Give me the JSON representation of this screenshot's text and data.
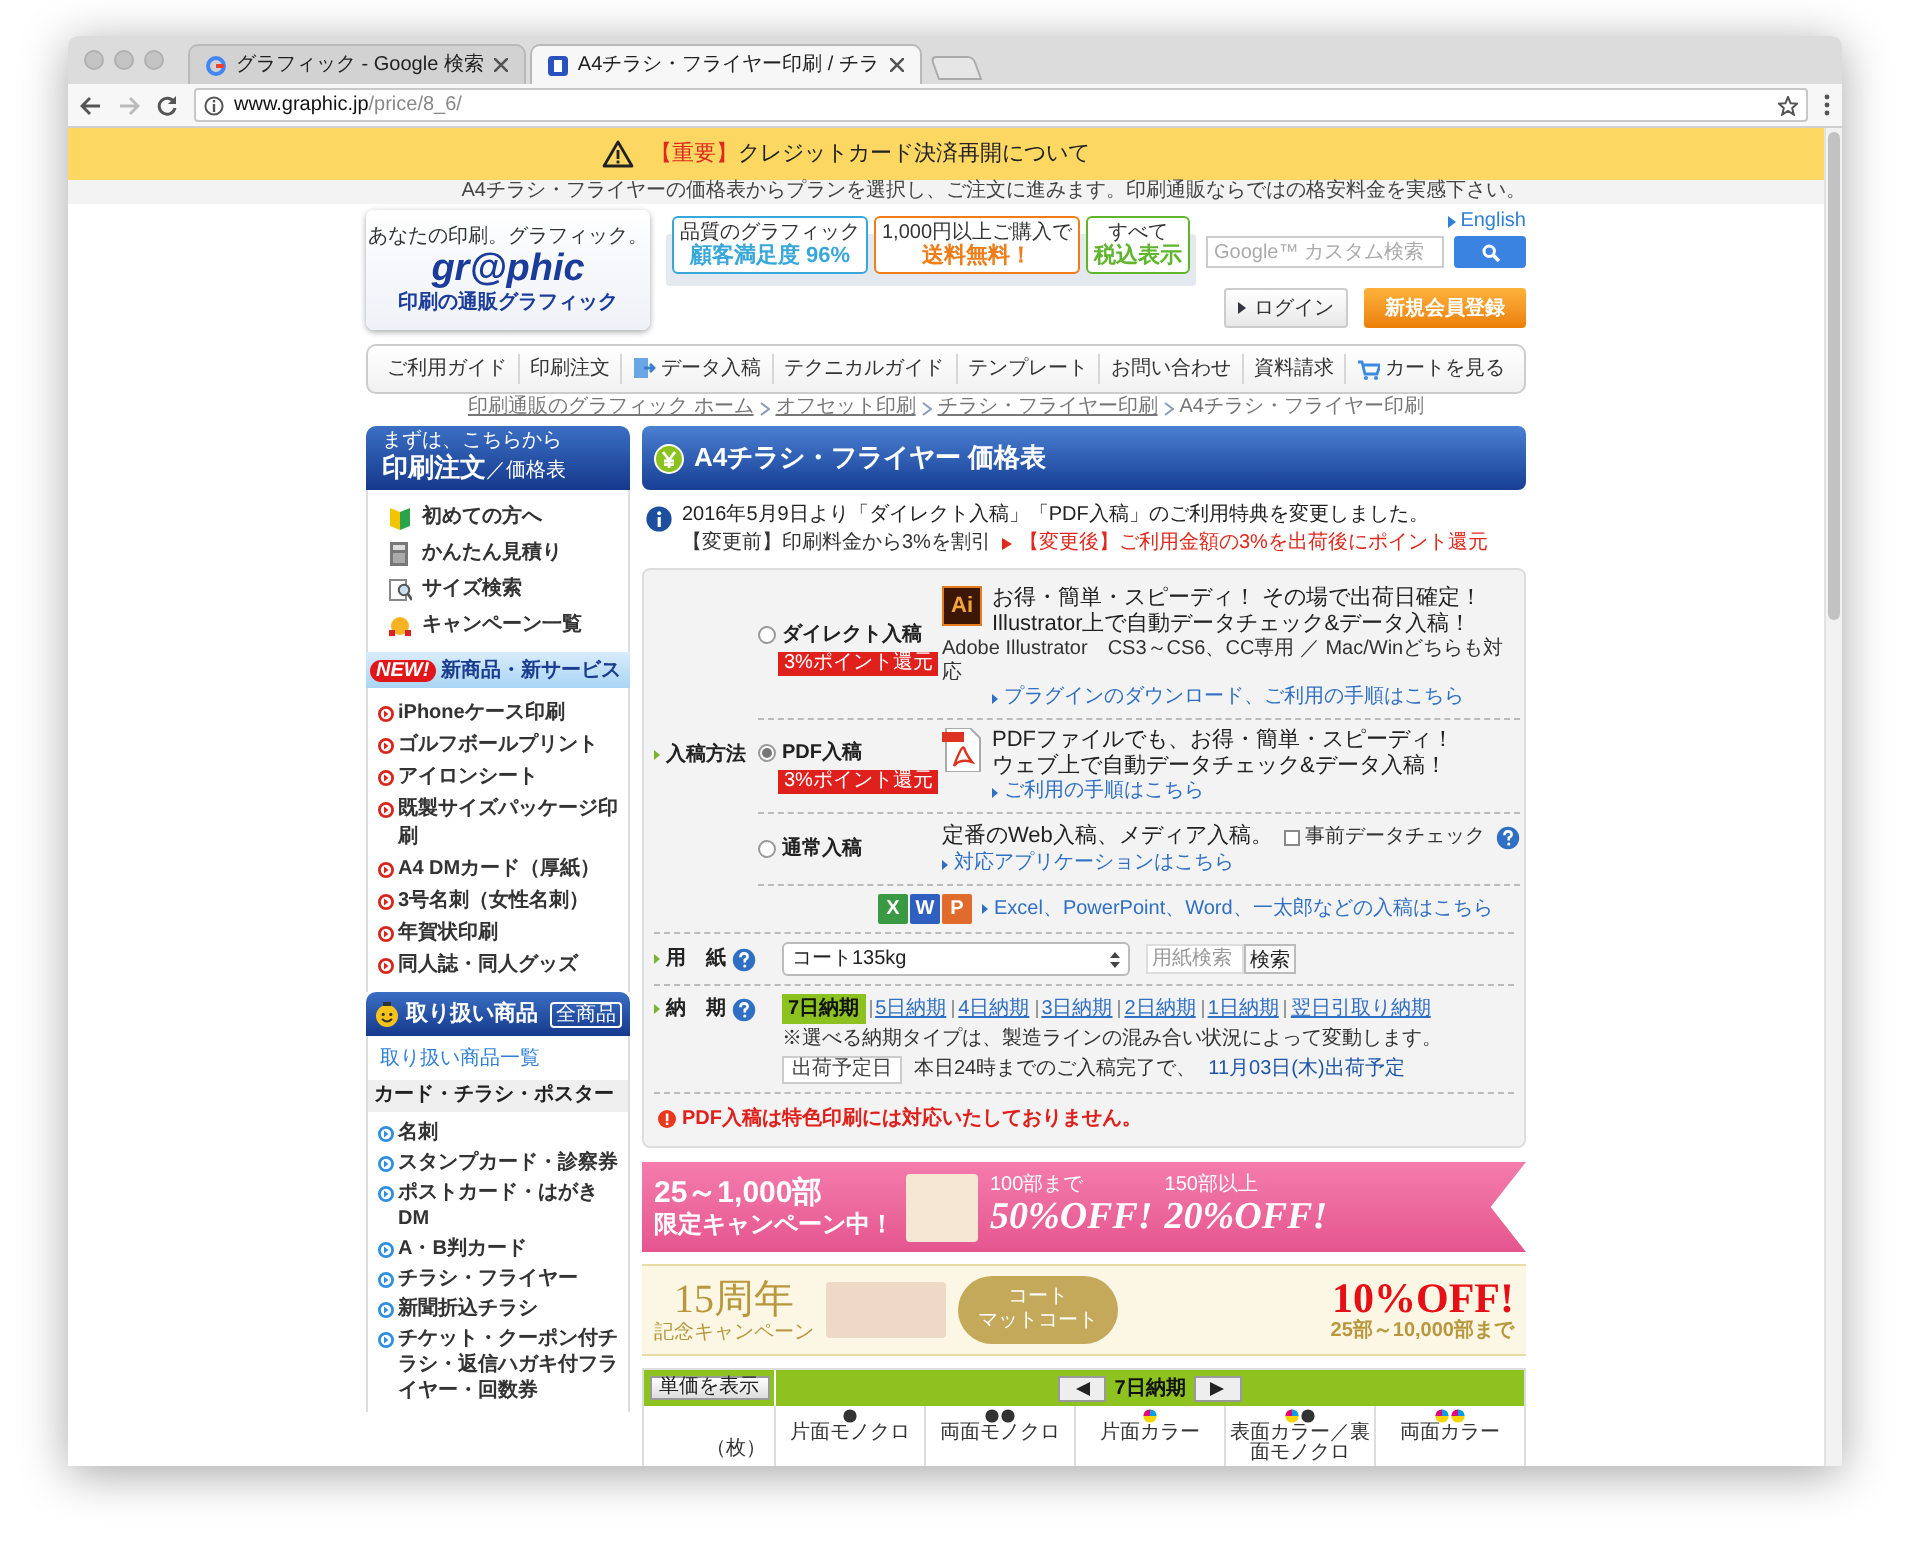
{
  "browser": {
    "tabs": [
      {
        "title": "グラフィック - Google 検索",
        "selected": false,
        "kind": "google"
      },
      {
        "title": "A4チラシ・フライヤー印刷 / チラ",
        "selected": true,
        "kind": "site"
      }
    ],
    "url_host": "www.graphic.jp",
    "url_path": "/price/8_6/"
  },
  "notice": {
    "tag": "【重要】",
    "text": "クレジットカード決済再開について"
  },
  "top_strip": "A4チラシ・フライヤーの価格表からプランを選択し、ご注文に進みます。印刷通販ならではの格安料金を実感下さい。",
  "header": {
    "tagline": "あなたの印刷。グラフィック。",
    "logo": "gr@phic",
    "logo_sub": "印刷の通販グラフィック",
    "badges": [
      {
        "top": "品質のグラフィック",
        "main": "顧客満足度 96%",
        "color": "#39a7d9"
      },
      {
        "top": "1,000円以上ご購入で",
        "main": "送料無料！",
        "color": "#ef7d1a"
      },
      {
        "top": "すべて",
        "main": "税込表示",
        "color": "#5fb52c"
      }
    ],
    "english": "English",
    "search_placeholder": "Google™ カスタム検索",
    "login": "ログイン",
    "register": "新規会員登録"
  },
  "nav": [
    {
      "label": "ご利用ガイド",
      "kind": "plain"
    },
    {
      "label": "印刷注文",
      "kind": "plain"
    },
    {
      "label": "データ入稿",
      "kind": "upload"
    },
    {
      "label": "テクニカルガイド",
      "kind": "plain"
    },
    {
      "label": "テンプレート",
      "kind": "plain"
    },
    {
      "label": "お問い合わせ",
      "kind": "plain"
    },
    {
      "label": "資料請求",
      "kind": "plain"
    },
    {
      "label": "カートを見る",
      "kind": "cart"
    }
  ],
  "breadcrumb": [
    "印刷通販のグラフィック ホーム",
    "オフセット印刷",
    "チラシ・フライヤー印刷",
    "A4チラシ・フライヤー印刷"
  ],
  "sidebar": {
    "order_header": {
      "small": "まずは、こちらから",
      "title": "印刷注文",
      "sub": "／価格表"
    },
    "quick_links": [
      {
        "label": "初めての方へ",
        "kind": "beginner"
      },
      {
        "label": "かんたん見積り",
        "kind": "estimate"
      },
      {
        "label": "サイズ検索",
        "kind": "size"
      },
      {
        "label": "キャンペーン一覧",
        "kind": "campaign"
      }
    ],
    "new_header": {
      "badge": "NEW!",
      "title": "新商品・新サービス"
    },
    "new_items": [
      "iPhoneケース印刷",
      "ゴルフボールプリント",
      "アイロンシート",
      "既製サイズパッケージ印刷",
      "A4 DMカード（厚紙）",
      "3号名刺（女性名刺）",
      "年賀状印刷",
      "同人誌・同人グッズ"
    ],
    "products_header": {
      "title": "取り扱い商品",
      "button": "全商品"
    },
    "all_link": "取り扱い商品一覧",
    "category": "カード・チラシ・ポスター",
    "category_items": [
      "名刺",
      "スタンプカード・診察券",
      "ポストカード・はがきDM",
      "A・B判カード",
      "チラシ・フライヤー",
      "新聞折込チラシ",
      "チケット・クーポン付チラシ・返信ハガキ付フライヤー・回数券"
    ]
  },
  "main": {
    "title": "A4チラシ・フライヤー 価格表",
    "info": {
      "text": "2016年5月9日より「ダイレクト入稿」「PDF入稿」のご利用特典を変更しました。",
      "before": "【変更前】印刷料金から3%を割引",
      "after": "【変更後】ご利用金額の3%を出荷後にポイント還元"
    },
    "method_label": "入稿方法",
    "methods": [
      {
        "kind": "ai",
        "label": "ダイレクト入稿",
        "selected": false,
        "badge": "3%ポイント還元",
        "icon_text": "Ai",
        "headline": [
          "お得・簡単・スピーディ！ その場で出荷日確定！",
          "Illustrator上で自動データチェック&データ入稿！"
        ],
        "note": "Adobe Illustrator　CS3～CS6、CC専用 ／ Mac/Winどちらも対応",
        "link": "プラグインのダウンロード、ご利用の手順はこちら"
      },
      {
        "kind": "pdf",
        "label": "PDF入稿",
        "selected": true,
        "badge": "3%ポイント還元",
        "headline": [
          "PDFファイルでも、お得・簡単・スピーディ！",
          "ウェブ上で自動データチェック&データ入稿！"
        ],
        "link": "ご利用の手順はこちら"
      },
      {
        "kind": "normal",
        "label": "通常入稿",
        "selected": false,
        "headline": [
          "定番のWeb入稿、メディア入稿。"
        ],
        "link": "対応アプリケーションはこちら",
        "check": {
          "label": "事前データチェック",
          "checked": false
        }
      }
    ],
    "office": {
      "icons": [
        "X",
        "W",
        "P"
      ],
      "link": "Excel、PowerPoint、Word、一太郎などの入稿はこちら"
    },
    "paper": {
      "label": "用　紙",
      "value": "コート135kg",
      "search_placeholder": "用紙検索",
      "search_button": "検索"
    },
    "delivery": {
      "label": "納　期",
      "options": [
        {
          "label": "7日納期",
          "selected": true
        },
        {
          "label": "5日納期",
          "selected": false
        },
        {
          "label": "4日納期",
          "selected": false
        },
        {
          "label": "3日納期",
          "selected": false
        },
        {
          "label": "2日納期",
          "selected": false
        },
        {
          "label": "1日納期",
          "selected": false
        },
        {
          "label": "翌日引取り納期",
          "selected": false
        }
      ],
      "note": "※選べる納期タイプは、製造ラインの混み合い状況によって変動します。",
      "ship_tag": "出荷予定日",
      "ship_text": "本日24時までのご入稿完了で、",
      "ship_date": "11月03日(木)出荷予定"
    },
    "warning": "PDF入稿は特色印刷には対応いたしておりません。",
    "campaign_banner": {
      "range": "25～1,000部",
      "sub": "限定キャンペーン中！",
      "deal1_top": "100部まで",
      "deal1": "50%OFF!",
      "deal2_top": "150部以上",
      "deal2": "20%OFF!"
    },
    "anniversary_banner": {
      "title": "15周年",
      "sub": "記念キャンペーン",
      "paper1": "コート",
      "paper2": "マットコート",
      "deal": "10%OFF!",
      "range": "25部～10,000部まで"
    },
    "price_table": {
      "unit_button": "単価を表示",
      "period": "7日納期",
      "unit": "（枚）",
      "columns": [
        {
          "label": "片面モノクロ",
          "kind": "mono1"
        },
        {
          "label": "両面モノクロ",
          "kind": "mono2"
        },
        {
          "label": "片面カラー",
          "kind": "color1"
        },
        {
          "label": "表面カラー／裏面モノクロ",
          "kind": "mixed"
        },
        {
          "label": "両面カラー",
          "kind": "color2"
        }
      ]
    }
  }
}
